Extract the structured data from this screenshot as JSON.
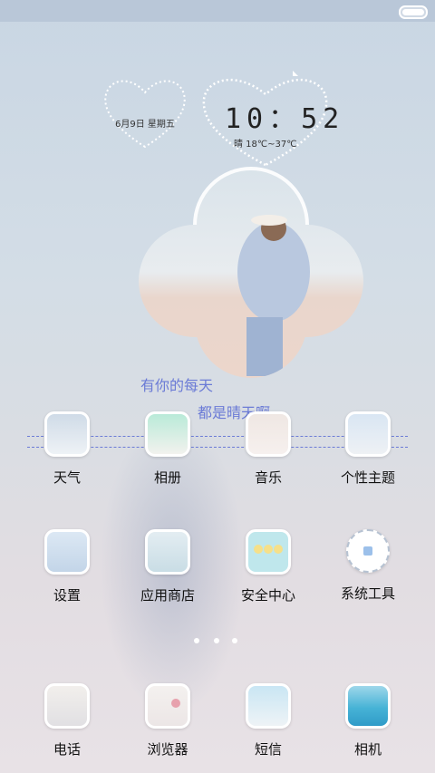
{
  "status_bar": {
    "battery_level": 1.0
  },
  "clock_widget": {
    "date": "6月9日 星期五",
    "time": "10：52",
    "weather": "晴 18℃~37℃"
  },
  "caption": {
    "line1": "有你的每天",
    "line2": "都是晴天啊"
  },
  "apps_row1": [
    {
      "label": "天气",
      "icon": "weather-icon"
    },
    {
      "label": "相册",
      "icon": "gallery-icon"
    },
    {
      "label": "音乐",
      "icon": "music-icon"
    },
    {
      "label": "个性主题",
      "icon": "themes-icon"
    }
  ],
  "apps_row2": [
    {
      "label": "设置",
      "icon": "settings-icon"
    },
    {
      "label": "应用商店",
      "icon": "app-store-icon"
    },
    {
      "label": "安全中心",
      "icon": "security-center-icon"
    },
    {
      "label": "系统工具",
      "icon": "system-tools-icon"
    }
  ],
  "page_indicator": {
    "pages": 3,
    "current": 1
  },
  "dock": [
    {
      "label": "电话",
      "icon": "phone-icon"
    },
    {
      "label": "浏览器",
      "icon": "browser-icon"
    },
    {
      "label": "短信",
      "icon": "messages-icon"
    },
    {
      "label": "相机",
      "icon": "camera-icon"
    }
  ]
}
